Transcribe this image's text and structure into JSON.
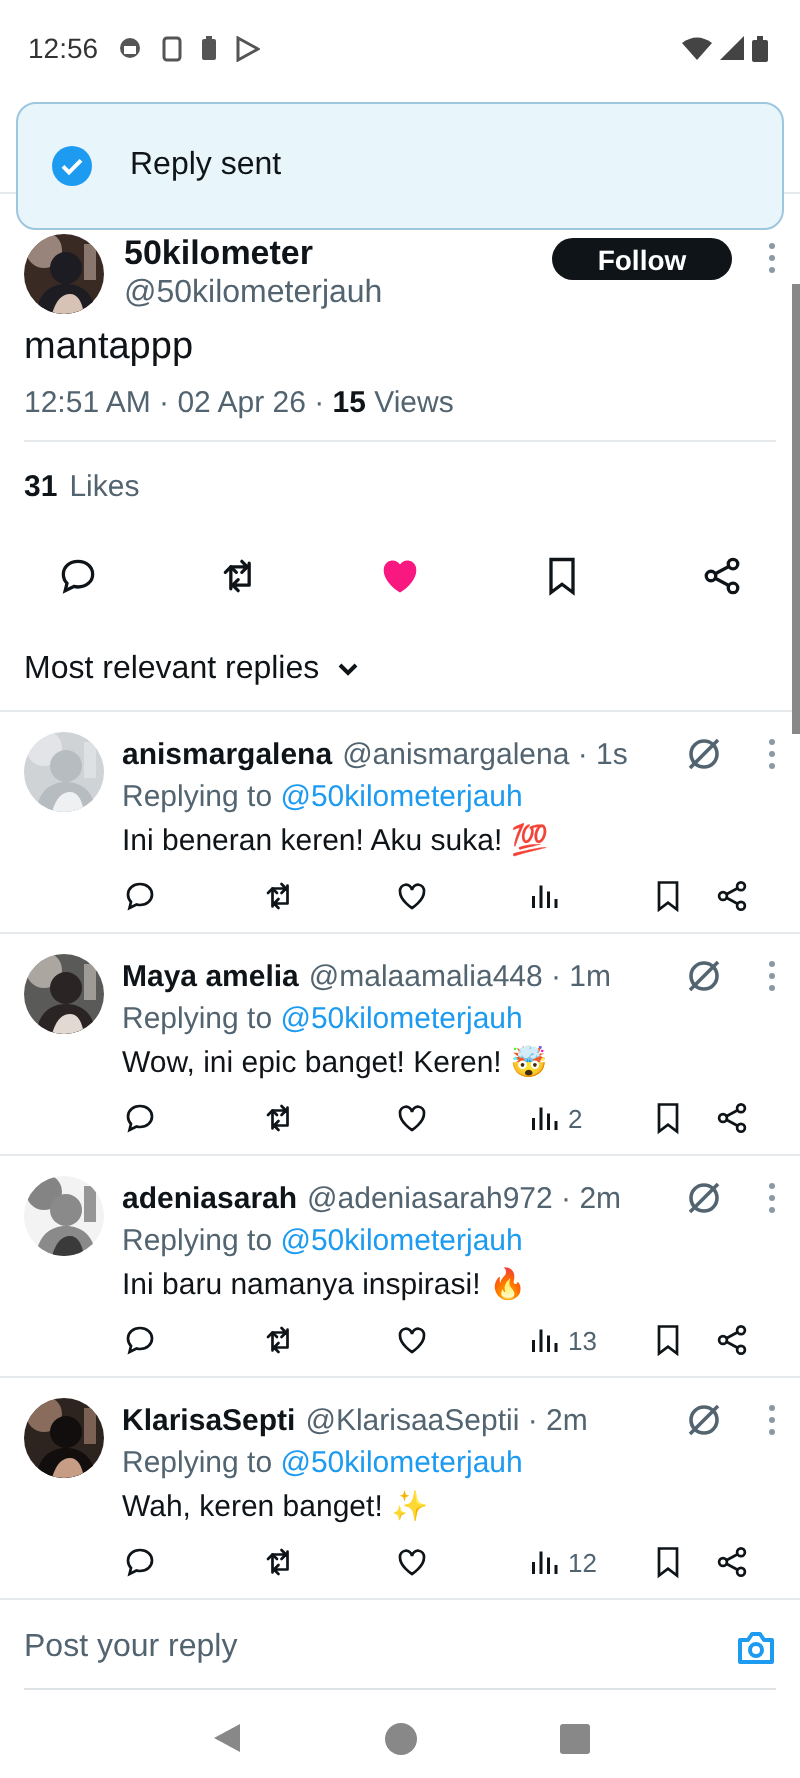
{
  "status_bar": {
    "time": "12:56"
  },
  "toast": {
    "text": "Reply sent"
  },
  "post": {
    "author": {
      "name": "50kilometer",
      "handle": "@50kilometerjauh"
    },
    "follow_button": "Follow",
    "text": "mantappp",
    "meta": "12:51 AM · 02 Apr 26 · **15** Views",
    "likes_count": "31",
    "likes_label": "Likes",
    "liked": true
  },
  "replies_filter": "Most relevant replies",
  "replies": [
    {
      "name": "anismargalena",
      "handle": "@anismargalena · 1s",
      "replying_label": "Replying to",
      "replying_to": "@50kilometerjauh",
      "text": "Ini beneran keren! Aku suka! 💯",
      "liked": false
    },
    {
      "name": "Maya amelia",
      "handle": "@malaamalia448 · 1m",
      "replying_label": "Replying to",
      "replying_to": "@50kilometerjauh",
      "text": "Wow, ini epic banget! Keren! 🤯",
      "liked": false,
      "views": "2"
    },
    {
      "name": "adeniasarah",
      "handle": "@adeniasarah972 · 2m",
      "replying_label": "Replying to",
      "replying_to": "@50kilometerjauh",
      "text": "Ini baru namanya inspirasi! 🔥",
      "liked": false,
      "views": "13"
    },
    {
      "name": "KlarisaSepti",
      "handle": "@KlarisaaSeptii · 2m",
      "replying_label": "Replying to",
      "replying_to": "@50kilometerjauh",
      "text": "Wah, keren banget! ✨",
      "liked": false,
      "views": "12"
    }
  ],
  "compose": {
    "placeholder": "Post your reply"
  }
}
